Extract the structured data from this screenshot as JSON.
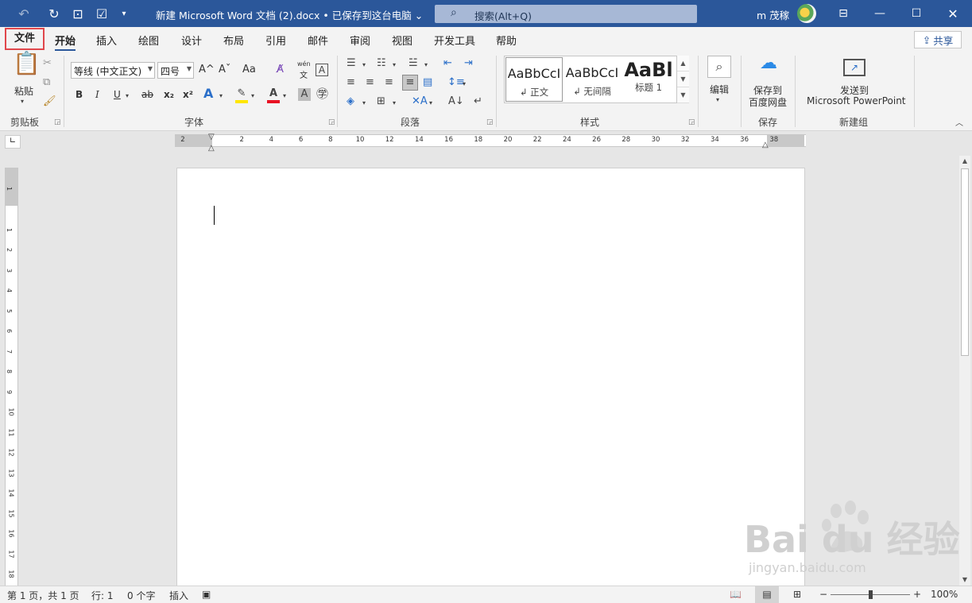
{
  "titlebar": {
    "document_title": "新建 Microsoft Word 文档 (2).docx • 已保存到这台电脑 ⌄",
    "search_placeholder": "搜索(Alt+Q)",
    "user_name": "m 茂稼",
    "bg_color": "#2b579a"
  },
  "tabs": [
    {
      "label": "文件"
    },
    {
      "label": "开始"
    },
    {
      "label": "插入"
    },
    {
      "label": "绘图"
    },
    {
      "label": "设计"
    },
    {
      "label": "布局"
    },
    {
      "label": "引用"
    },
    {
      "label": "邮件"
    },
    {
      "label": "审阅"
    },
    {
      "label": "视图"
    },
    {
      "label": "开发工具"
    },
    {
      "label": "帮助"
    }
  ],
  "share_label": "共享",
  "ribbon": {
    "clipboard": {
      "paste": "粘贴",
      "group": "剪贴板"
    },
    "font": {
      "font_name": "等线 (中文正文)",
      "font_size": "四号",
      "group": "字体",
      "bold": "B",
      "italic": "I",
      "underline": "U",
      "strike": "ab",
      "subscript": "x₂",
      "superscript": "x²",
      "change_case": "Aa",
      "grow": "A^",
      "shrink": "Aˇ",
      "pinyin": "wén",
      "pinyin_char": "文"
    },
    "paragraph": {
      "group": "段落"
    },
    "styles": {
      "items": [
        {
          "sample": "AaBbCcI",
          "name": "↲ 正文"
        },
        {
          "sample": "AaBbCcI",
          "name": "↲ 无间隔"
        },
        {
          "sample": "AaBl",
          "name": "标题 1"
        }
      ],
      "group": "样式"
    },
    "editing": {
      "label": "编辑"
    },
    "save": {
      "label_line1": "保存到",
      "label_line2": "百度网盘",
      "group": "保存"
    },
    "newgroup": {
      "label_line1": "发送到",
      "label_line2": "Microsoft PowerPoint",
      "group": "新建组"
    }
  },
  "ruler": {
    "numbers": [
      "2",
      "2",
      "4",
      "6",
      "8",
      "10",
      "12",
      "14",
      "16",
      "18",
      "20",
      "22",
      "24",
      "26",
      "28",
      "30",
      "32",
      "34",
      "36",
      "38"
    ]
  },
  "vruler": {
    "numbers": [
      "1",
      "1",
      "2",
      "3",
      "4",
      "5",
      "6",
      "7",
      "8",
      "9",
      "10",
      "11",
      "12",
      "13",
      "14",
      "15",
      "16",
      "17",
      "18"
    ]
  },
  "status": {
    "page": "第 1 页，共 1 页",
    "line": "行: 1",
    "words": "0 个字",
    "mode": "插入",
    "zoom": "100%"
  },
  "watermark": {
    "brand": "Bai du 经验",
    "url": "jingyan.baidu.com"
  }
}
